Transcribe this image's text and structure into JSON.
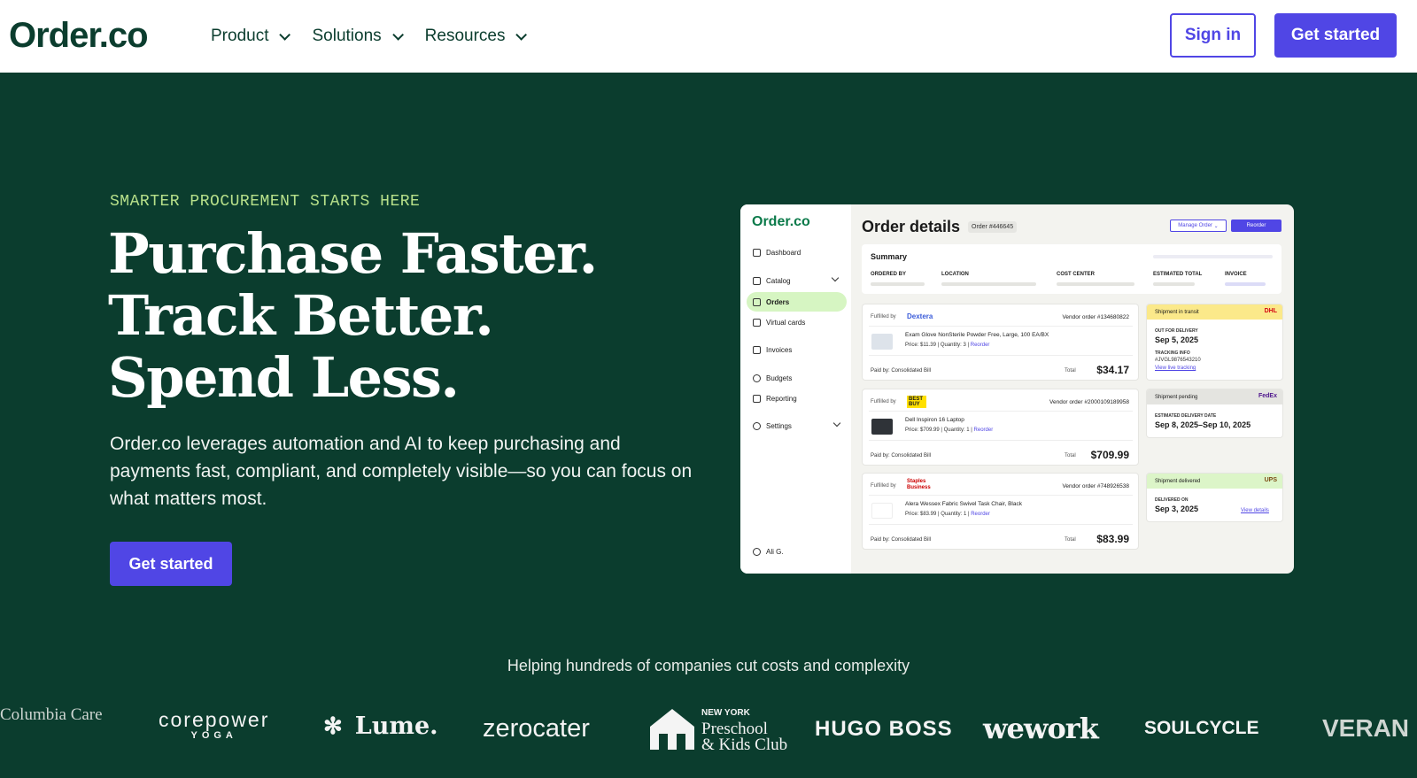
{
  "header": {
    "logo": "Order.co",
    "nav": [
      {
        "label": "Product"
      },
      {
        "label": "Solutions"
      },
      {
        "label": "Resources"
      }
    ],
    "sign_in": "Sign in",
    "get_started": "Get started"
  },
  "hero": {
    "eyebrow": "SMARTER PROCUREMENT STARTS HERE",
    "headline": [
      "Purchase Faster.",
      "Track Better.",
      "Spend Less."
    ],
    "subtext": "Order.co leverages automation and AI to keep purchasing and payments fast, compliant, and completely visible—so you can focus on what matters most.",
    "cta": "Get started"
  },
  "mockup": {
    "logo": "Order.co",
    "sidebar": [
      "Dashboard",
      "Catalog",
      "Orders",
      "Virtual cards",
      "Invoices",
      "Budgets",
      "Reporting",
      "Settings"
    ],
    "user": "Ali G.",
    "title": "Order details",
    "order_no": "Order #446645",
    "manage_btn": "Manage Order",
    "reorder_btn": "Reorder",
    "summary": {
      "title": "Summary",
      "cols": [
        "ORDERED BY",
        "LOCATION",
        "COST CENTER",
        "ESTIMATED TOTAL",
        "INVOICE"
      ]
    },
    "orders": [
      {
        "fulfilled_by": "Fulfilled by",
        "vendor": "Dextera",
        "vendor_order": "Vendor order #134680822",
        "item": "Exam Glove NonSterile Powder Free, Large, 100 EA/BX",
        "price": "Price: $11.39",
        "qty": "Quantity: 3",
        "reorder": "Reorder",
        "paid_by": "Paid by: Consolidated Bill",
        "total_label": "Total",
        "total": "$34.17"
      },
      {
        "fulfilled_by": "Fulfilled by",
        "vendor": "BEST BUY",
        "vendor_order": "Vendor order #2000109189958",
        "item": "Dell Inspiron 16 Laptop",
        "price": "Price: $709.99",
        "qty": "Quantity: 1",
        "reorder": "Reorder",
        "paid_by": "Paid by: Consolidated Bill",
        "total_label": "Total",
        "total": "$709.99"
      },
      {
        "fulfilled_by": "Fulfilled by",
        "vendor": "Staples Business",
        "vendor_order": "Vendor order #748926538",
        "item": "Alera Wessex Fabric Swivel Task Chair, Black",
        "price": "Price: $83.99",
        "qty": "Quantity: 1",
        "reorder": "Reorder",
        "paid_by": "Paid by: Consolidated Bill",
        "total_label": "Total",
        "total": "$83.99"
      }
    ],
    "shipments": [
      {
        "status": "Shipment in transit",
        "carrier": "DHL",
        "color": "#fbe98a",
        "label1": "OUT FOR DELIVERY",
        "value1": "Sep 5, 2025",
        "label2": "TRACKING INFO",
        "tracking": "#JVGL9876543210",
        "link": "View live tracking"
      },
      {
        "status": "Shipment pending",
        "carrier": "FedEx",
        "color": "#e4e4e0",
        "label1": "ESTIMATED DELIVERY DATE",
        "value1": "Sep 8, 2025–Sep 10, 2025"
      },
      {
        "status": "Shipment delivered",
        "carrier": "UPS",
        "color": "#dcf5c8",
        "label1": "DELIVERED ON",
        "value1": "Sep 3, 2025",
        "link": "View details"
      }
    ]
  },
  "logos": {
    "title": "Helping hundreds of companies cut costs and complexity",
    "brands": [
      "Columbia Care",
      "corepower",
      "YOGA",
      "Lume.",
      "zerocater",
      "NEW YORK",
      "Preschool",
      "& Kids Club",
      "HUGO BOSS",
      "wework",
      "SOULCYCLE",
      "VERAN"
    ]
  },
  "colors": {
    "brand_green": "#0b3d2e",
    "accent_purple": "#5046e5",
    "eyebrow_green": "#b7e08a"
  }
}
